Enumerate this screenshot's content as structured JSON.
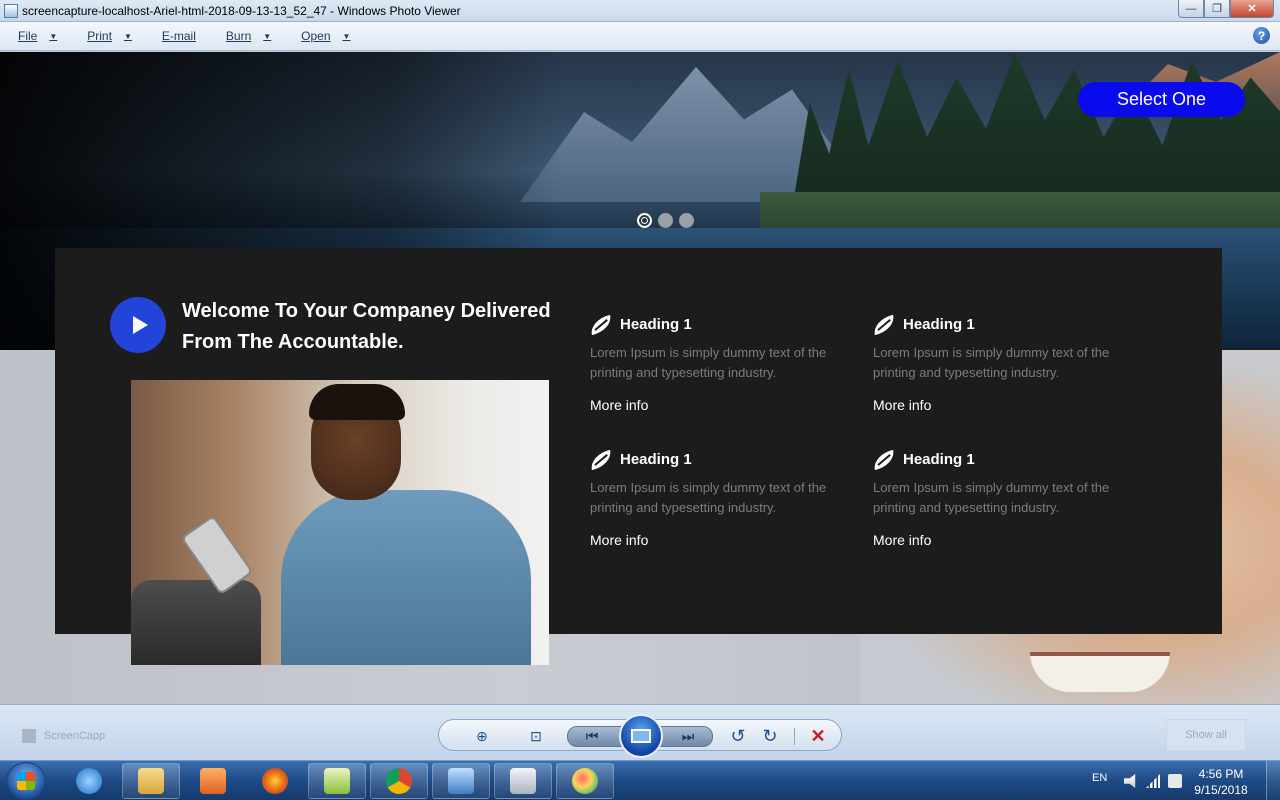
{
  "window": {
    "title": "screencapture-localhost-Ariel-html-2018-09-13-13_52_47 - Windows Photo Viewer",
    "minimize": "—",
    "maximize": "❐",
    "close": "✕"
  },
  "menu": {
    "items": [
      {
        "label": "File",
        "has_arrow": true
      },
      {
        "label": "Print",
        "has_arrow": true
      },
      {
        "label": "E-mail",
        "has_arrow": false
      },
      {
        "label": "Burn",
        "has_arrow": true
      },
      {
        "label": "Open",
        "has_arrow": true
      }
    ],
    "help": "?"
  },
  "page": {
    "select_button": "Select One",
    "carousel": {
      "count": 3,
      "active_index": 0
    },
    "welcome": "Welcome To Your Companey Delivered From The Accountable.",
    "features": [
      {
        "heading": "Heading 1",
        "description": "Lorem Ipsum is simply dummy text of the printing and typesetting industry.",
        "link": "More info"
      },
      {
        "heading": "Heading 1",
        "description": "Lorem Ipsum is simply dummy text of the printing and typesetting industry.",
        "link": "More info"
      },
      {
        "heading": "Heading 1",
        "description": "Lorem Ipsum is simply dummy text of the printing and typesetting industry.",
        "link": "More info"
      },
      {
        "heading": "Heading 1",
        "description": "Lorem Ipsum is simply dummy text of the printing and typesetting industry.",
        "link": "More info"
      }
    ],
    "colors": {
      "accent_blue": "#0a0aee",
      "play_blue": "#2244d8",
      "panel_bg": "#1c1c1c"
    }
  },
  "viewer_toolbar": {
    "ghost_left": "ScreenCapp",
    "ghost_right": "Show all",
    "zoom_icon": "⊕",
    "actual_size_icon": "⊡",
    "prev_icon": "⏮",
    "next_icon": "⏭",
    "rotate_ccw_icon": "↺",
    "rotate_cw_icon": "↻",
    "delete_icon": "✕"
  },
  "taskbar": {
    "apps": [
      "internet-explorer",
      "file-explorer",
      "media-player",
      "firefox",
      "chart-app",
      "chrome",
      "photo-viewer",
      "calculator",
      "paint"
    ],
    "lang": "EN",
    "time": "4:56 PM",
    "date": "9/15/2018"
  }
}
